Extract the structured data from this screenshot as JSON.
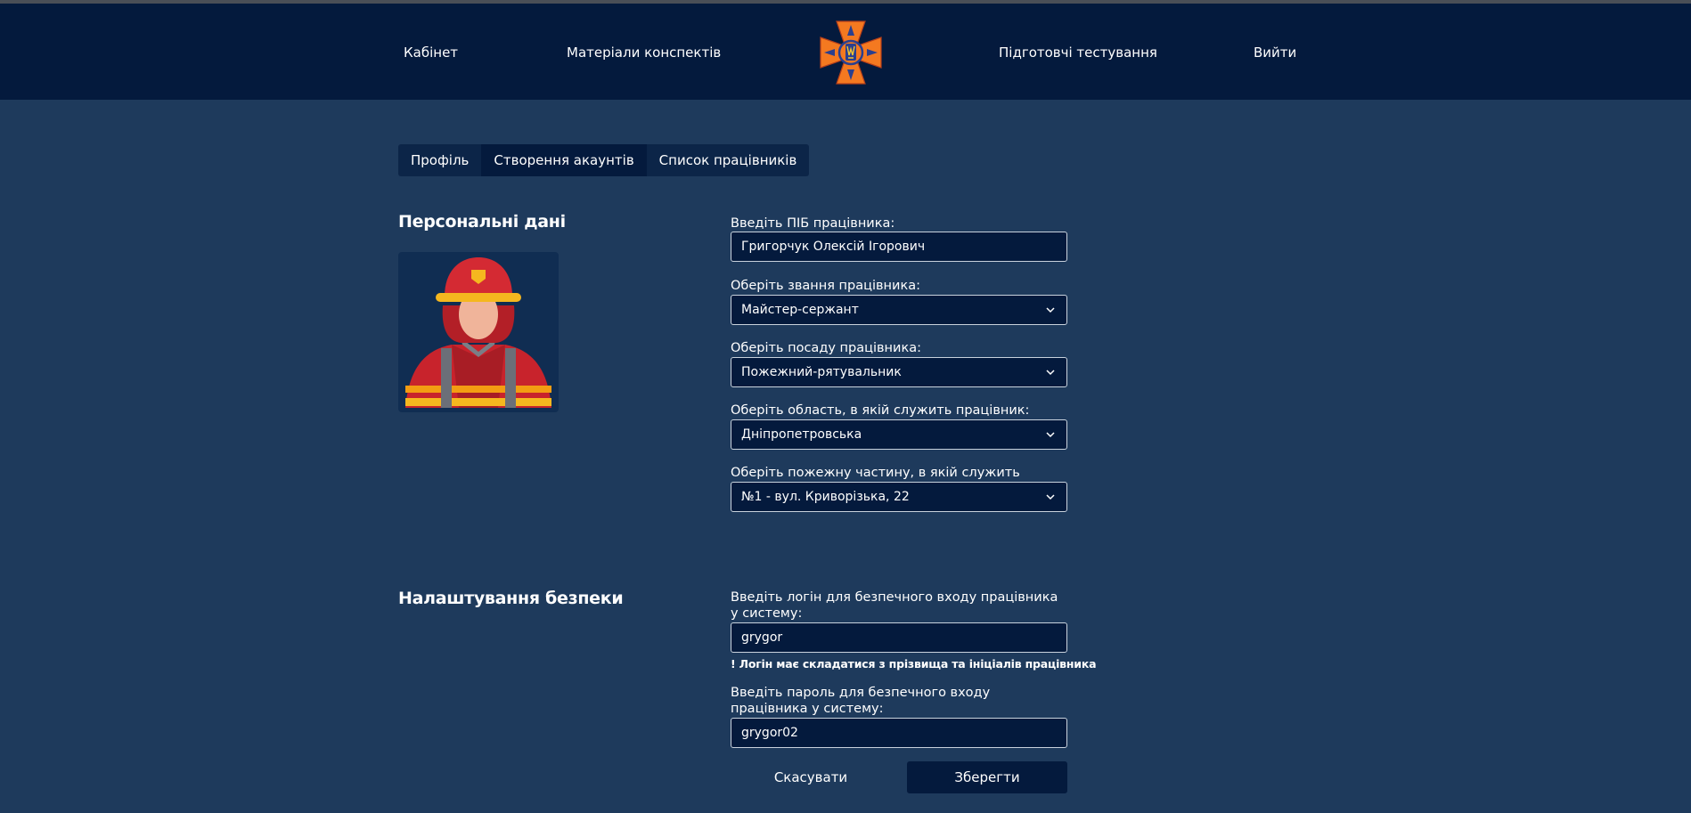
{
  "nav": {
    "cabinet": "Кабінет",
    "materials": "Матеріали конспектів",
    "tests": "Підготовчі тестування",
    "logout": "Вийти"
  },
  "tabs": [
    {
      "label": "Профіль",
      "active": false
    },
    {
      "label": "Створення акаунтів",
      "active": true
    },
    {
      "label": "Список працівників",
      "active": false
    }
  ],
  "personal": {
    "title": "Персональні дані",
    "name_label": "Введіть ПІБ працівника:",
    "name_value": "Григорчук Олексій Ігорович",
    "rank_label": "Оберіть звання працівника:",
    "rank_value": "Майстер-сержант",
    "position_label": "Оберіть посаду працівника:",
    "position_value": "Пожежний-рятувальник",
    "region_label": "Оберіть область, в якій служить працівник:",
    "region_value": "Дніпропетровська",
    "unit_label": "Оберіть пожежну частину, в якій служить працівник:",
    "unit_value": "№1 - вул. Криворізька, 22"
  },
  "security": {
    "title": "Налаштування безпеки",
    "login_label": "Введіть логін для безпечного входу працівника у систему:",
    "login_value": "grygor",
    "login_hint": "! Логін має складатися з прізвища та ініціалів працівника",
    "password_label": "Введіть пароль для безпечного входу працівника у систему:",
    "password_value": "grygor02"
  },
  "actions": {
    "cancel": "Скасувати",
    "save": "Зберегти"
  },
  "icons": {
    "logo": "civil-protection-cross-logo",
    "avatar": "firefighter-avatar",
    "chevron": "chevron-down-icon"
  },
  "colors": {
    "background": "#1e3a5c",
    "navbar": "#041a3d",
    "logo_orange": "#f47920",
    "logo_blue": "#2a3f8f"
  }
}
